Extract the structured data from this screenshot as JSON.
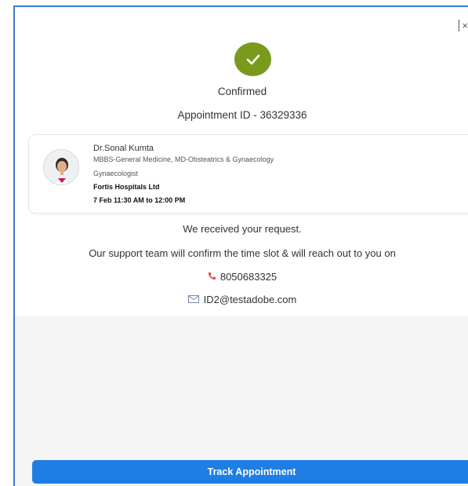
{
  "confirmation": {
    "status": "Confirmed",
    "appointment_id": "Appointment ID - 36329336"
  },
  "doctor": {
    "name": "Dr.Sonal Kumta",
    "qualifications": "MBBS-General Medicine, MD-Obsteatrics & Gynaecology",
    "role": "Gynaecologist",
    "hospital": "Fortis Hospitals Ltd",
    "slot": "7 Feb 11:30 AM to 12:00 PM"
  },
  "messages": {
    "received": "We received your request.",
    "support": "Our support team will confirm the time slot & will reach out to you on"
  },
  "contact": {
    "phone": "8050683325",
    "email": "ID2@testadobe.com"
  },
  "actions": {
    "track_label": "Track Appointment"
  },
  "icons": {
    "check": "check-icon",
    "phone": "phone-icon",
    "email": "mail-icon",
    "close": "close-icon"
  },
  "colors": {
    "check_bg": "#7a9a1c",
    "primary_button": "#1e7ee4",
    "phone_icon": "#d9534f"
  }
}
